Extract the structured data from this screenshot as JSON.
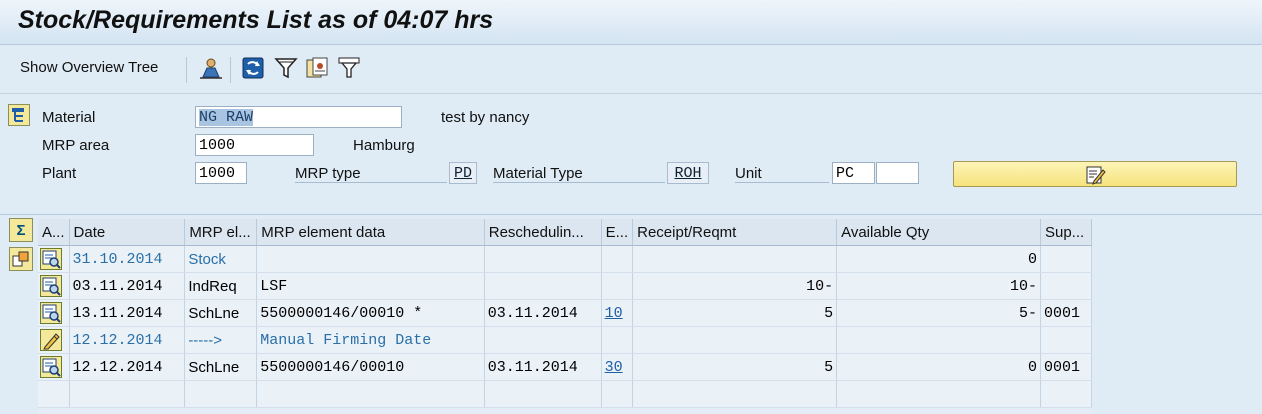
{
  "title": "Stock/Requirements List as of 04:07 hrs",
  "toolbar": {
    "show_overview_tree": "Show Overview Tree",
    "icons": [
      "person-icon",
      "refresh-icon",
      "filter-icon",
      "settings-icon",
      "select-icon"
    ]
  },
  "header": {
    "material_label": "Material",
    "material_value": "NG RAW",
    "material_desc": "test by nancy",
    "mrp_area_label": "MRP area",
    "mrp_area_value": "1000",
    "mrp_area_desc": "Hamburg",
    "plant_label": "Plant",
    "plant_value": "1000",
    "mrp_type_label": "MRP type",
    "mrp_type_value": "PD",
    "material_type_label": "Material Type",
    "material_type_value": "ROH",
    "unit_label": "Unit",
    "unit_value": "PC",
    "unit_value2": ""
  },
  "grid": {
    "columns": [
      "A...",
      "Date",
      "MRP el...",
      "MRP element data",
      "Reschedulin...",
      "E...",
      "Receipt/Reqmt",
      "Available Qty",
      "Sup..."
    ],
    "rows": [
      {
        "icon": "detail-icon",
        "date": "31.10.2014",
        "mrp_el": "Stock",
        "data": "",
        "resched": "",
        "e": "",
        "receipt": "",
        "available": "0",
        "sup": "",
        "style": "blue"
      },
      {
        "icon": "detail-icon",
        "date": "03.11.2014",
        "mrp_el": "IndReq",
        "data": "LSF",
        "resched": "",
        "e": "",
        "receipt": "10-",
        "available": "10-",
        "sup": "",
        "style": ""
      },
      {
        "icon": "detail-icon",
        "date": "13.11.2014",
        "mrp_el": "SchLne",
        "data": "5500000146/00010 *",
        "resched": "03.11.2014",
        "e": "10",
        "receipt": "5",
        "available": "5-",
        "sup": "0001",
        "style": ""
      },
      {
        "icon": "pencil-icon",
        "date": "12.12.2014",
        "mrp_el": "----->",
        "data": "Manual Firming Date",
        "resched": "",
        "e": "",
        "receipt": "",
        "available": "",
        "sup": "",
        "style": "blue"
      },
      {
        "icon": "detail-icon",
        "date": "12.12.2014",
        "mrp_el": "SchLne",
        "data": "5500000146/00010",
        "resched": "03.11.2014",
        "e": "30",
        "receipt": "5",
        "available": "0",
        "sup": "0001",
        "style": ""
      }
    ]
  },
  "colors": {
    "accent": "#2a6fa8",
    "button_yellow": "#f4e99a",
    "background": "#dfebf5"
  }
}
